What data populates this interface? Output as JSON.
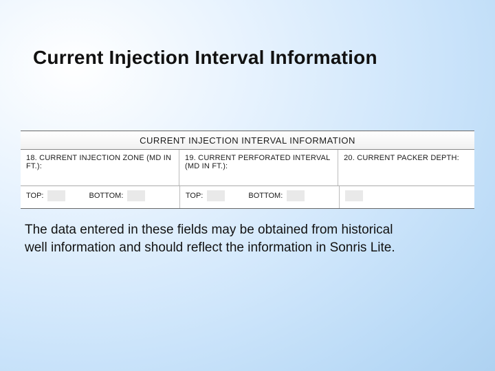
{
  "title": "Current Injection Interval Information",
  "form": {
    "header": "CURRENT INJECTION INTERVAL INFORMATION",
    "fields": {
      "f18": {
        "label": "18. CURRENT INJECTION ZONE (MD IN FT.):",
        "top": "TOP:",
        "bottom": "BOTTOM:"
      },
      "f19": {
        "label": "19. CURRENT PERFORATED INTERVAL (MD IN FT.):",
        "top": "TOP:",
        "bottom": "BOTTOM:"
      },
      "f20": {
        "label": "20. CURRENT PACKER DEPTH:"
      }
    }
  },
  "body": "The data entered in these fields may be obtained from historical well information and should reflect the information in Sonris Lite."
}
